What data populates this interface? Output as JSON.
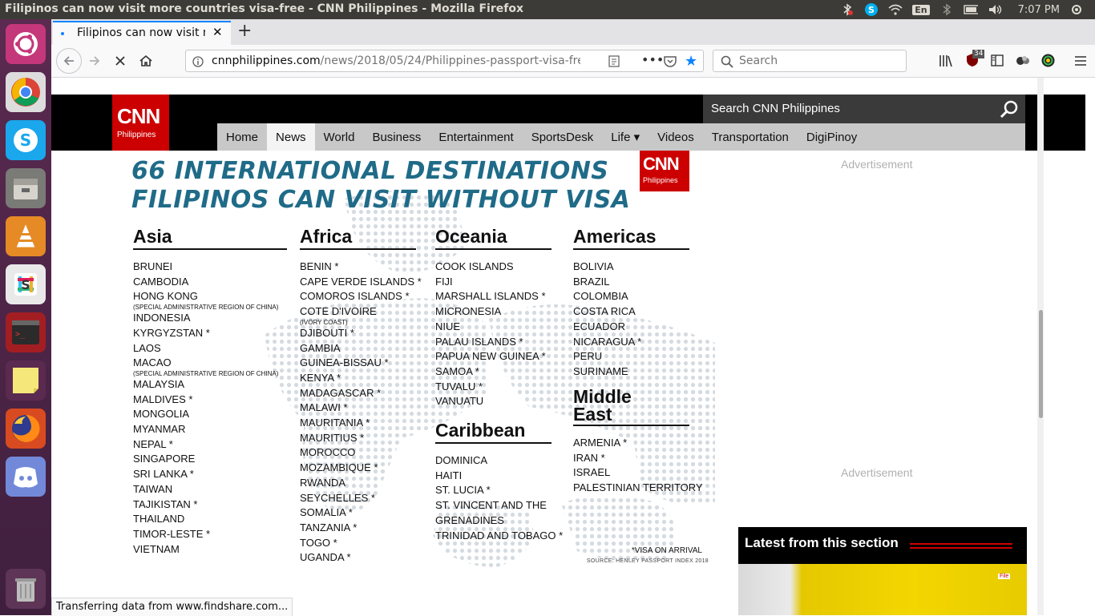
{
  "window": {
    "title": "Filipinos can now visit more countries visa-free - CNN Philippines - Mozilla Firefox"
  },
  "system_tray": {
    "time": "7:07 PM",
    "keyboard_layout": "En",
    "icons": [
      "bluetooth-icon",
      "skype-icon",
      "wifi-icon",
      "keyboard-icon",
      "bluetooth-icon",
      "battery-icon",
      "volume-icon"
    ]
  },
  "launcher": {
    "apps": [
      "ubuntu-dash",
      "chrome",
      "skype",
      "files",
      "vlc",
      "slack",
      "terminal",
      "sticky-notes",
      "firefox",
      "discord",
      "trash"
    ]
  },
  "browser": {
    "tab_title": "Filipinos can now visit m",
    "url_host": "cnnphilippines.com",
    "url_path": "/news/2018/05/24/Philippines-passport-visa-fre",
    "search_placeholder": "Search",
    "ublock_badge": "34",
    "status_text": "Transferring data from www.findshare.com..."
  },
  "site": {
    "logo_text": "CNN",
    "logo_sub": "Philippines",
    "search_placeholder": "Search CNN Philippines",
    "nav": [
      "Home",
      "News",
      "World",
      "Business",
      "Entertainment",
      "SportsDesk",
      "Life ▾",
      "Videos",
      "Transportation",
      "DigiPinoy"
    ],
    "active_nav": "News"
  },
  "infographic": {
    "title_line1": "66 INTERNATIONAL DESTINATIONS",
    "title_line2": "FILIPINOS CAN VISIT WITHOUT VISA",
    "visa_note": "*VISA ON ARRIVAL",
    "source": "SOURCE: HENLEY PASSPORT INDEX 2018",
    "regions": {
      "asia": {
        "name": "Asia",
        "items": [
          "BRUNEI",
          "CAMBODIA",
          "HONG KONG",
          "INDONESIA",
          "KYRGYZSTAN *",
          "LAOS",
          "MACAO",
          "MALAYSIA",
          "MALDIVES *",
          "MONGOLIA",
          "MYANMAR",
          "NEPAL *",
          "SINGAPORE",
          "SRI LANKA *",
          "TAIWAN",
          "TAJIKISTAN *",
          "THAILAND",
          "TIMOR-LESTE *",
          "VIETNAM"
        ],
        "hk_note": "(SPECIAL ADMINISTRATIVE REGION OF CHINA)",
        "macao_note": "(SPECIAL ADMINISTRATIVE REGION OF CHINA)"
      },
      "africa": {
        "name": "Africa",
        "items": [
          "BENIN *",
          "CAPE VERDE ISLANDS *",
          "COMOROS ISLANDS *",
          "COTE D'IVOIRE",
          "DJIBOUTI *",
          "GAMBIA",
          "GUINEA-BISSAU *",
          "KENYA *",
          "MADAGASCAR *",
          "MALAWI *",
          "MAURITANIA *",
          "MAURITIUS *",
          "MOROCCO",
          "MOZAMBIQUE *",
          "RWANDA",
          "SEYCHELLES *",
          "SOMALIA *",
          "TANZANIA *",
          "TOGO *",
          "UGANDA *"
        ],
        "ivory_note": "(IVORY COAST)"
      },
      "oceania": {
        "name": "Oceania",
        "items": [
          "COOK ISLANDS",
          "FIJI",
          "MARSHALL ISLANDS *",
          "MICRONESIA",
          "NIUE",
          "PALAU ISLANDS *",
          "PAPUA NEW GUINEA *",
          "SAMOA *",
          "TUVALU *",
          "VANUATU"
        ]
      },
      "caribbean": {
        "name": "Caribbean",
        "items": [
          "DOMINICA",
          "HAITI",
          "ST. LUCIA *",
          "ST. VINCENT AND THE",
          "GRENADINES",
          "TRINIDAD AND TOBAGO *"
        ]
      },
      "americas": {
        "name": "Americas",
        "items": [
          "BOLIVIA",
          "BRAZIL",
          "COLOMBIA",
          "COSTA RICA",
          "ECUADOR",
          "NICARAGUA *",
          "PERU",
          "SURINAME"
        ]
      },
      "middle_east": {
        "name_line1": "Middle",
        "name_line2": "East",
        "items": [
          "ARMENIA *",
          "IRAN *",
          "ISRAEL",
          "PALESTINIAN TERRITORY"
        ]
      }
    }
  },
  "sidebar": {
    "ad_label_1": "Advertisement",
    "ad_label_2": "Advertisement",
    "latest_title": "Latest from this section",
    "latest_thumb_label": "File"
  }
}
